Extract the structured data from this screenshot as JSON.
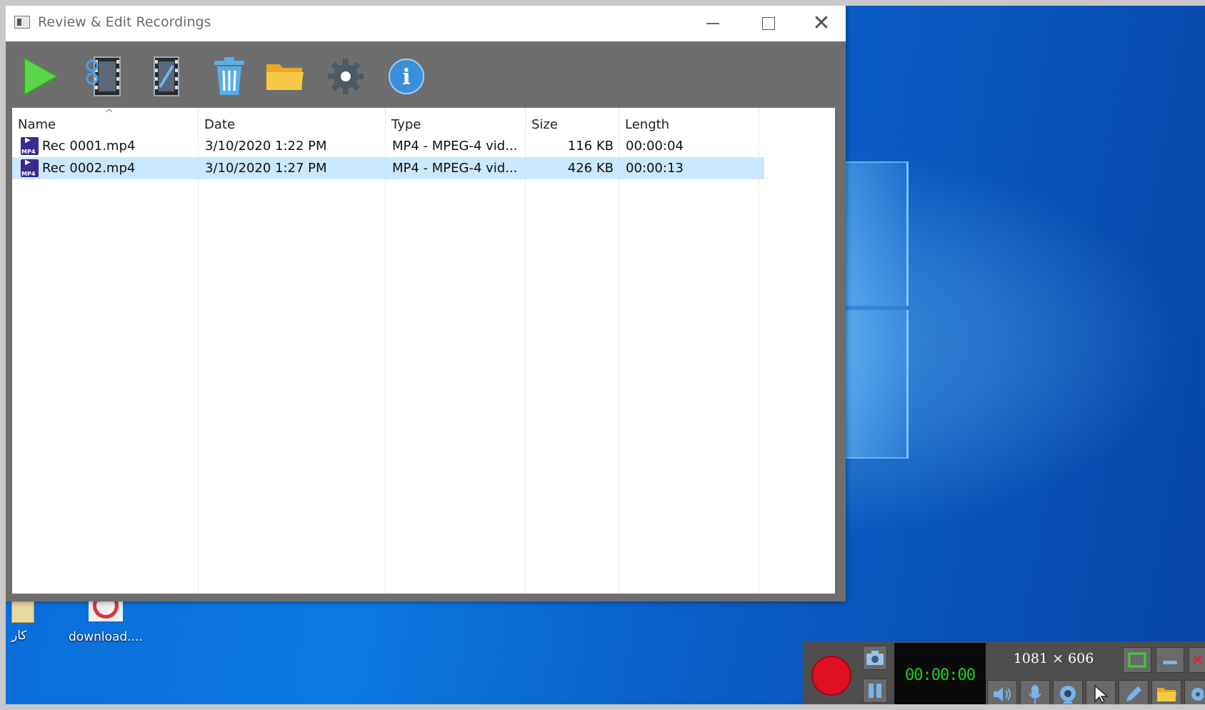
{
  "window": {
    "title": "Review & Edit Recordings"
  },
  "toolbar": {
    "buttons": [
      {
        "name": "play",
        "icon": "play-icon"
      },
      {
        "name": "cut-video",
        "icon": "film-scissors-icon"
      },
      {
        "name": "edit-video",
        "icon": "film-edit-icon"
      },
      {
        "name": "delete",
        "icon": "trash-icon"
      },
      {
        "name": "open-folder",
        "icon": "folder-icon"
      },
      {
        "name": "settings",
        "icon": "gear-icon"
      },
      {
        "name": "info",
        "icon": "info-icon"
      }
    ]
  },
  "list": {
    "columns": [
      "Name",
      "Date",
      "Type",
      "Size",
      "Length"
    ],
    "rows": [
      {
        "name": "Rec 0001.mp4",
        "date": "3/10/2020 1:22 PM",
        "type": "MP4 - MPEG-4 vid...",
        "size": "116 KB",
        "length": "00:00:04",
        "selected": false
      },
      {
        "name": "Rec 0002.mp4",
        "date": "3/10/2020 1:27 PM",
        "type": "MP4 - MPEG-4 vid...",
        "size": "426 KB",
        "length": "00:00:13",
        "selected": true
      }
    ]
  },
  "desktop": {
    "icons": [
      {
        "label": "کار"
      },
      {
        "label": "download...."
      }
    ]
  },
  "recorder": {
    "timer": "00:00:00",
    "dimensions": "1081 × 606"
  },
  "colors": {
    "accent": "#cce8ff",
    "record": "#e01020",
    "timer": "#1fd01f",
    "toolbar": "#6e6e6e"
  }
}
